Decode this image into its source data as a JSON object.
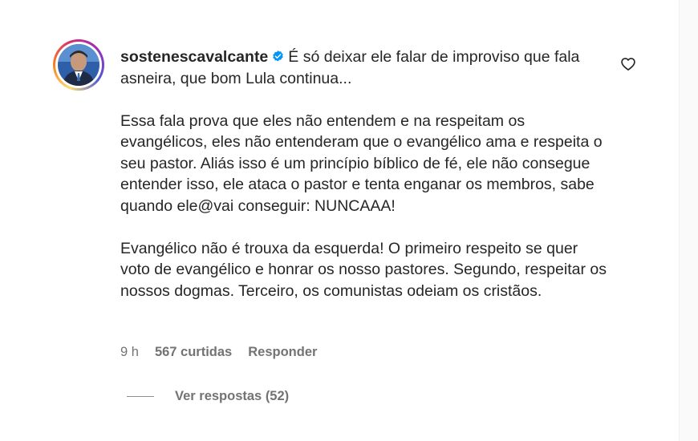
{
  "comment": {
    "username": "sostenescavalcante",
    "verified": true,
    "paragraphs": [
      "É só deixar ele falar de improviso que fala asneira, que bom Lula continua...",
      "Essa fala prova que eles não entendem e na respeitam os evangélicos, eles não entenderam que o evangélico ama e respeita o seu pastor. Aliás isso é um princípio bíblico de fé, ele não consegue entender isso, ele ataca o pastor e tenta enganar os membros, sabe quando ele@vai conseguir: NUNCAAA!",
      "Evangélico não é trouxa da esquerda! O primeiro respeito se quer voto de evangélico e honrar os nosso pastores. Segundo, respeitar os nossos dogmas. Terceiro, os comunistas odeiam os cristãos."
    ],
    "time": "9 h",
    "likes": "567 curtidas",
    "reply_label": "Responder",
    "view_replies": "Ver respostas (52)"
  },
  "icons": {
    "like": "heart-outline-icon",
    "verified": "verified-badge-icon"
  },
  "colors": {
    "text": "#262626",
    "secondary": "#737373",
    "verified_blue": "#0095f6",
    "ring_gradient": [
      "#feda75",
      "#fa7e1e",
      "#d62976",
      "#962fbf",
      "#4f5bd5"
    ]
  }
}
